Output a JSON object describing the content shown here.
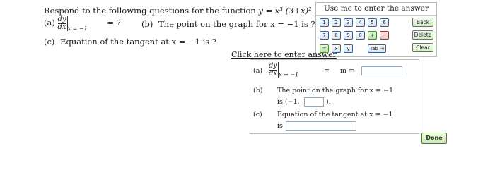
{
  "question": {
    "intro": "Respond to the following questions for the function",
    "func_y": "y",
    "func_eq": "=",
    "func_rhs": "x³ (3+x)².",
    "a_label": "(a)",
    "a_num": "dy",
    "a_den": "dx",
    "a_sub": "x = −1",
    "a_tail": "= ?",
    "b_label": "(b)",
    "b_text": "The point on the graph for x = −1 is ?",
    "c_label": "(c)",
    "c_text": "Equation of the tangent at x = −1 is ?"
  },
  "keypad": {
    "title": "Use me to enter the answer",
    "row1": [
      "1",
      "2",
      "3",
      "4",
      "5",
      "6"
    ],
    "row2": [
      "7",
      "8",
      "9",
      "0",
      "+",
      "−"
    ],
    "row3": [
      "=",
      "x",
      "y",
      "Tab ⇥"
    ],
    "back": "Back",
    "delete": "Delete",
    "clear": "Clear"
  },
  "click_here": "Click here to enter answer",
  "answer": {
    "a_label": "(a)",
    "a_num": "dy",
    "a_den": "dx",
    "a_sub": "x = −1",
    "a_eq": "=",
    "a_m": "m =",
    "b_label": "(b)",
    "b_text": "The point on the graph for x = −1",
    "b_is": "is (−1,",
    "b_close": ").",
    "c_label": "(c)",
    "c_text": "Equation of the tangent at x = −1",
    "c_is": "is"
  },
  "done": "Done"
}
